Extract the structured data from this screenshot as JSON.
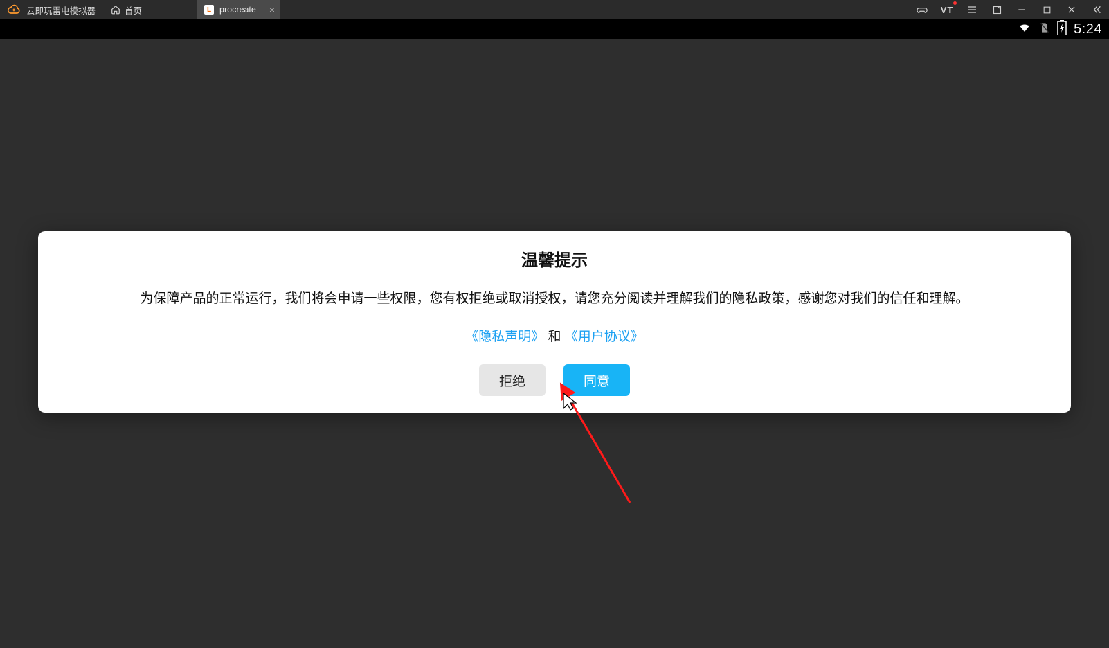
{
  "titlebar": {
    "app_name": "云即玩雷电模拟器",
    "home_label": "首页",
    "tab": {
      "label": "procreate",
      "close_glyph": "×"
    },
    "vt_label": "VT"
  },
  "statusbar": {
    "time": "5:24"
  },
  "dialog": {
    "title": "温馨提示",
    "body": "为保障产品的正常运行，我们将会申请一些权限，您有权拒绝或取消授权，请您充分阅读并理解我们的隐私政策，感谢您对我们的信任和理解。",
    "link_privacy": "《隐私声明》",
    "link_joiner": "和",
    "link_agreement": "《用户协议》",
    "btn_decline": "拒绝",
    "btn_agree": "同意"
  }
}
